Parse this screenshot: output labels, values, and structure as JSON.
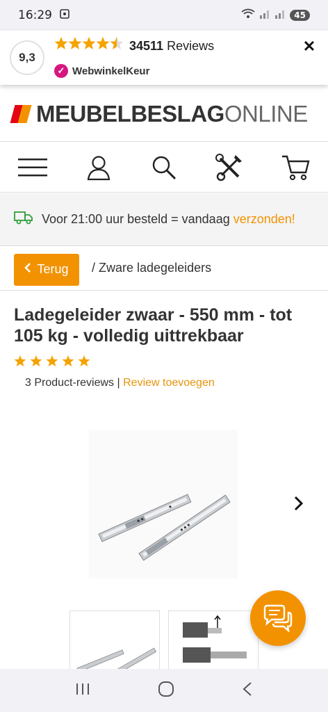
{
  "status": {
    "time": "16:29",
    "battery": "45"
  },
  "reviewbar": {
    "score": "9,3",
    "count": "34511",
    "reviews_label": "Reviews",
    "badge": "WebwinkelKeur",
    "close": "✕"
  },
  "brand": {
    "bold": "MEUBELBESLAG",
    "light": "ONLINE"
  },
  "nav": {
    "icons": [
      "menu-icon",
      "user-icon",
      "search-icon",
      "tools-icon",
      "cart-icon"
    ]
  },
  "shipping": {
    "text": "Voor 21:00 uur besteld = vandaag",
    "highlight": "verzonden!"
  },
  "breadcrumb": {
    "back_label": "Terug",
    "path": "/ Zware ladegeleiders"
  },
  "product": {
    "title": "Ladegeleider zwaar - 550 mm - tot 105 kg - volledig uittrekbaar",
    "rating_stars": 5,
    "reviews_count_label": "3 Product-reviews",
    "separator": "|",
    "add_review": "Review toevoegen"
  },
  "colors": {
    "accent": "#f39200",
    "brand_red": "#e30613",
    "star": "#f5a300"
  }
}
